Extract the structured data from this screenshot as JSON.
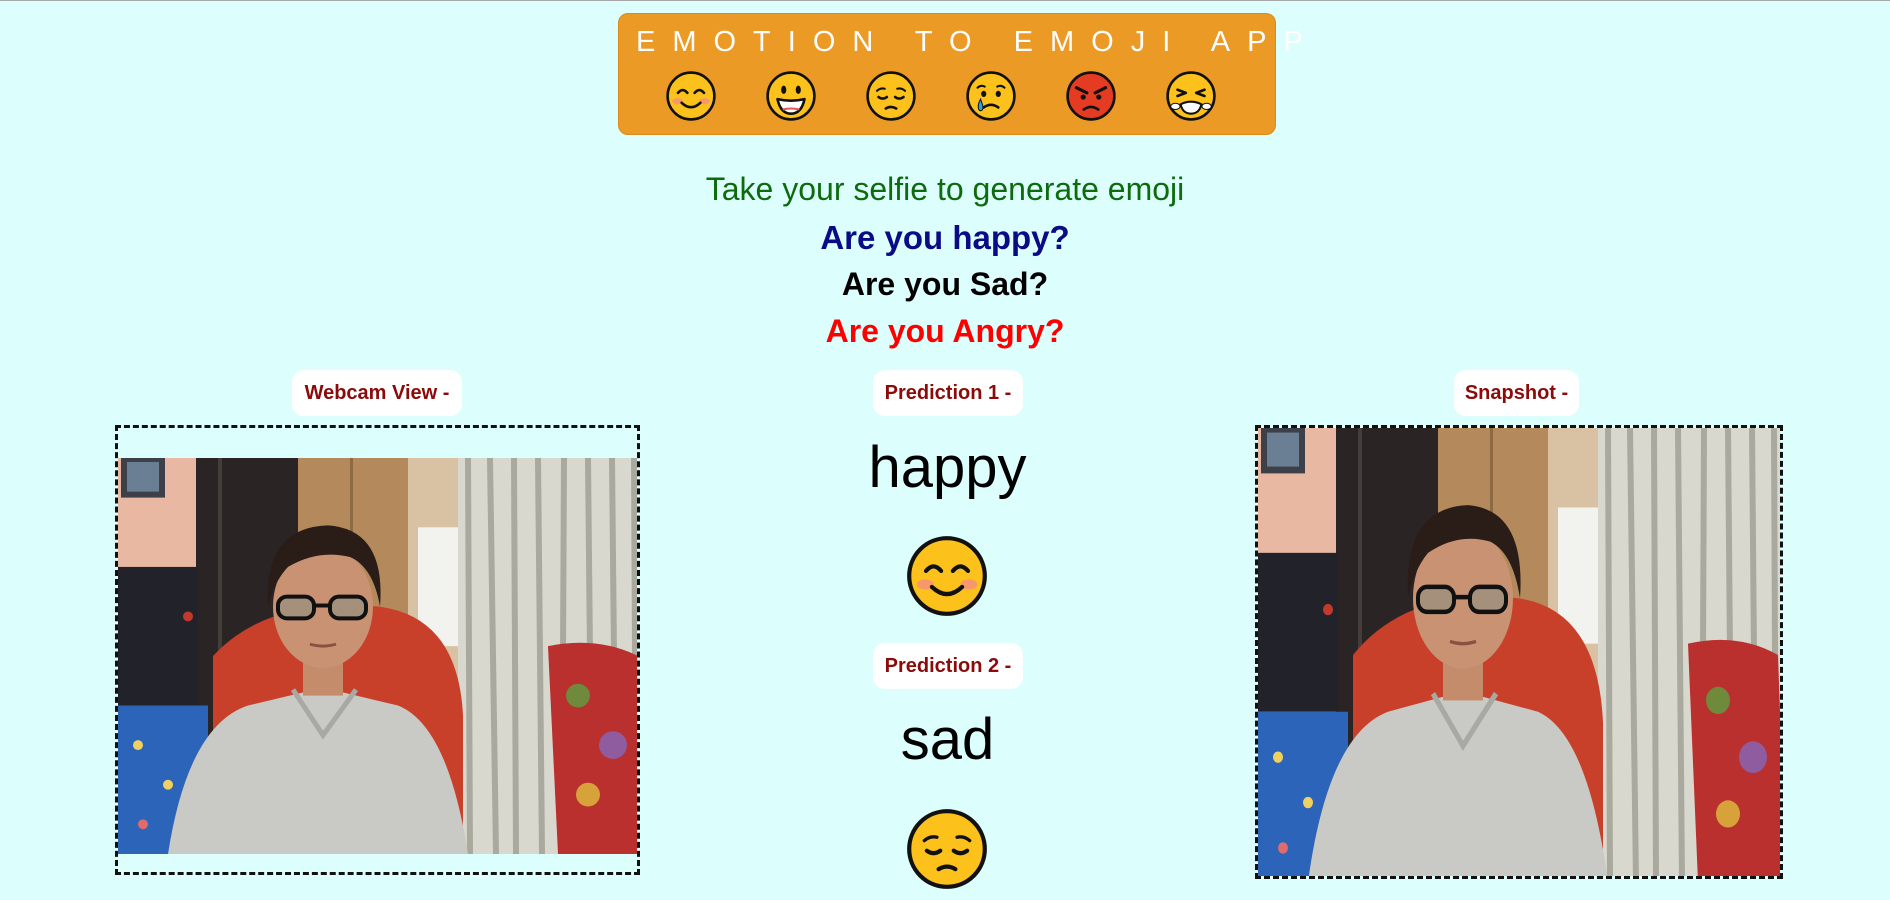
{
  "banner": {
    "title": "EMOTION TO EMOJI APP",
    "emojis": [
      "smiling-face-emoji",
      "grinning-face-emoji",
      "pensive-face-emoji",
      "crying-face-emoji",
      "angry-face-emoji",
      "tired-face-emoji"
    ],
    "background_color": "#ec9a26"
  },
  "intro": {
    "tagline": "Take your selfie to generate emoji",
    "questions": [
      "Are you happy?",
      "Are you Sad?",
      "Are you Angry?"
    ],
    "colors": [
      "#0d6b0d",
      "#0b0b85",
      "#000000",
      "#ff0000"
    ]
  },
  "webcam": {
    "label": "Webcam View -"
  },
  "snapshot": {
    "label": "Snapshot -"
  },
  "predictions": [
    {
      "label": "Prediction 1 -",
      "emotion": "happy",
      "emoji": "smiling-face-emoji"
    },
    {
      "label": "Prediction 2 -",
      "emotion": "sad",
      "emoji": "pensive-face-emoji"
    }
  ],
  "theme": {
    "page_background": "#dcfffe",
    "label_color": "#8b0a0a"
  }
}
